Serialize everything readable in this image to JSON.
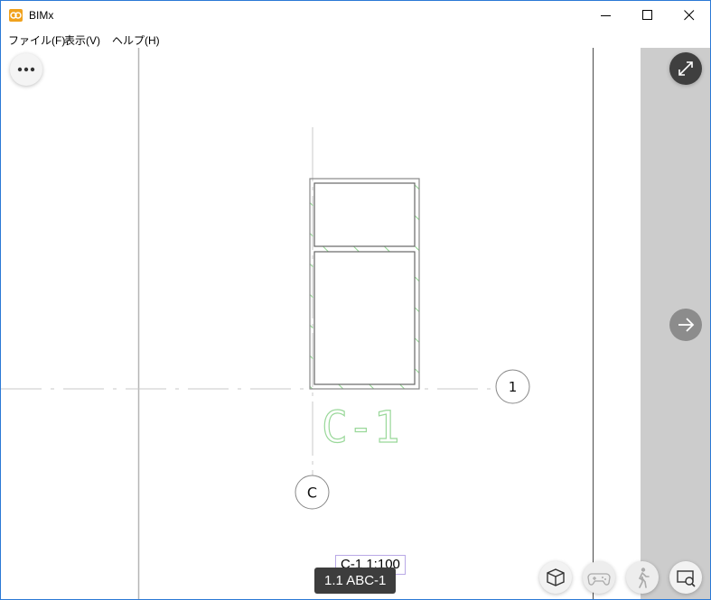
{
  "window": {
    "title": "BIMx"
  },
  "menu": {
    "items": [
      "ファイル(F)",
      "表示(V)",
      "ヘルプ(H)"
    ]
  },
  "drawing": {
    "column_label": "C-1",
    "grid_axis_number": "1",
    "grid_axis_letter": "C",
    "sheet_label": "C-1  1:100"
  },
  "tooltip": {
    "text": "1.1 ABC-1"
  },
  "controls": {
    "more": "more-icon",
    "fullscreen": "expand-icon",
    "next": "arrow-right-icon",
    "tools": [
      "model-3d-icon",
      "gamepad-icon",
      "walk-icon",
      "zoom-search-icon"
    ]
  },
  "colors": {
    "accent_border": "#2b79d6",
    "hatch": "#8fd48f",
    "panel": "#cccccc"
  }
}
